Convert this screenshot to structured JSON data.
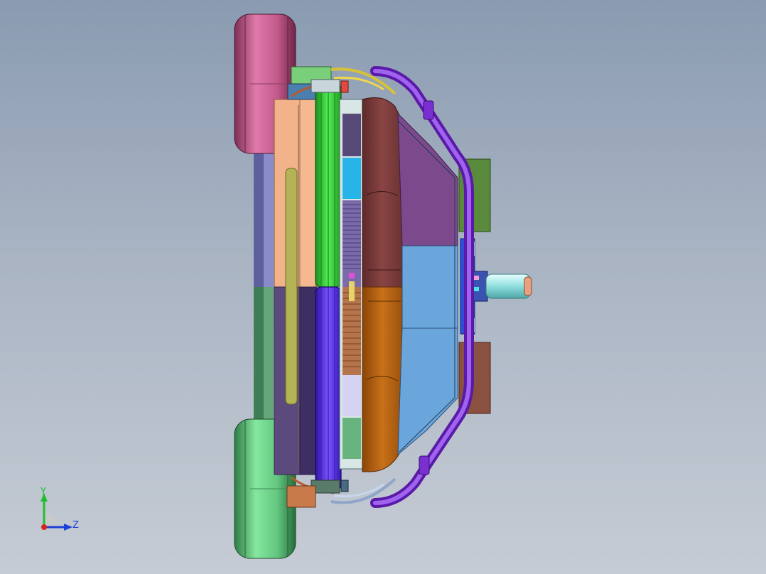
{
  "viewport": {
    "background_top": "#8a9bb1",
    "background_bottom": "#c6ccd5"
  },
  "model": {
    "name": "",
    "parts": [
      "wheel-top",
      "wheel-bottom",
      "frame-left",
      "panel-beige",
      "panel-purple",
      "green-belt",
      "violet-belt",
      "grille",
      "body-top",
      "body-bottom",
      "dash-top",
      "dash-bottom",
      "guard-rail",
      "back-box-top",
      "back-box-bottom",
      "hub",
      "shaft"
    ],
    "colors": {
      "wheel_top": "#c0588a",
      "wheel_bottom": "#6fd08a",
      "green_belt": "#39d23a",
      "violet_belt": "#5a2ee0",
      "guard_rail": "#8a2be2",
      "body_top": "#7a3b3b",
      "body_bottom": "#b5600f",
      "dash_top": "#7c4a8c",
      "dash_bottom": "#6a9fd8",
      "hub": "#2c4fd8",
      "shaft": "#8ee0e0"
    }
  },
  "triad": {
    "y_label": "Y",
    "z_label": "Z",
    "y_color": "#1fbf2e",
    "z_color": "#1d3fd6",
    "x_color": "#d8261c"
  }
}
